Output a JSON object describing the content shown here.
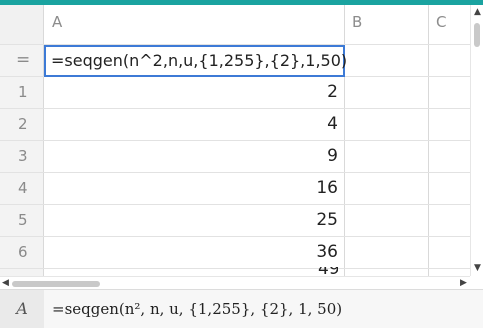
{
  "columns": {
    "a": "A",
    "b": "B",
    "c": "C"
  },
  "formula_row": {
    "marker": "=",
    "formula": "=seqgen(n^2,n,u,{1,255},{2},1,50)"
  },
  "rows": [
    {
      "num": "1",
      "value": "2"
    },
    {
      "num": "2",
      "value": "4"
    },
    {
      "num": "3",
      "value": "9"
    },
    {
      "num": "4",
      "value": "16"
    },
    {
      "num": "5",
      "value": "25"
    },
    {
      "num": "6",
      "value": "36"
    }
  ],
  "entry_line": {
    "cell_ref": "A",
    "expression": "=seqgen(n², n, u, {1,255}, {2}, 1, 50)"
  },
  "colors": {
    "accent_bar": "#1aa3a0",
    "selection": "#3d7ad6"
  },
  "icons": [
    "scroll-up-arrow-icon",
    "scroll-down-arrow-icon",
    "scroll-left-arrow-icon",
    "scroll-right-arrow-icon"
  ]
}
